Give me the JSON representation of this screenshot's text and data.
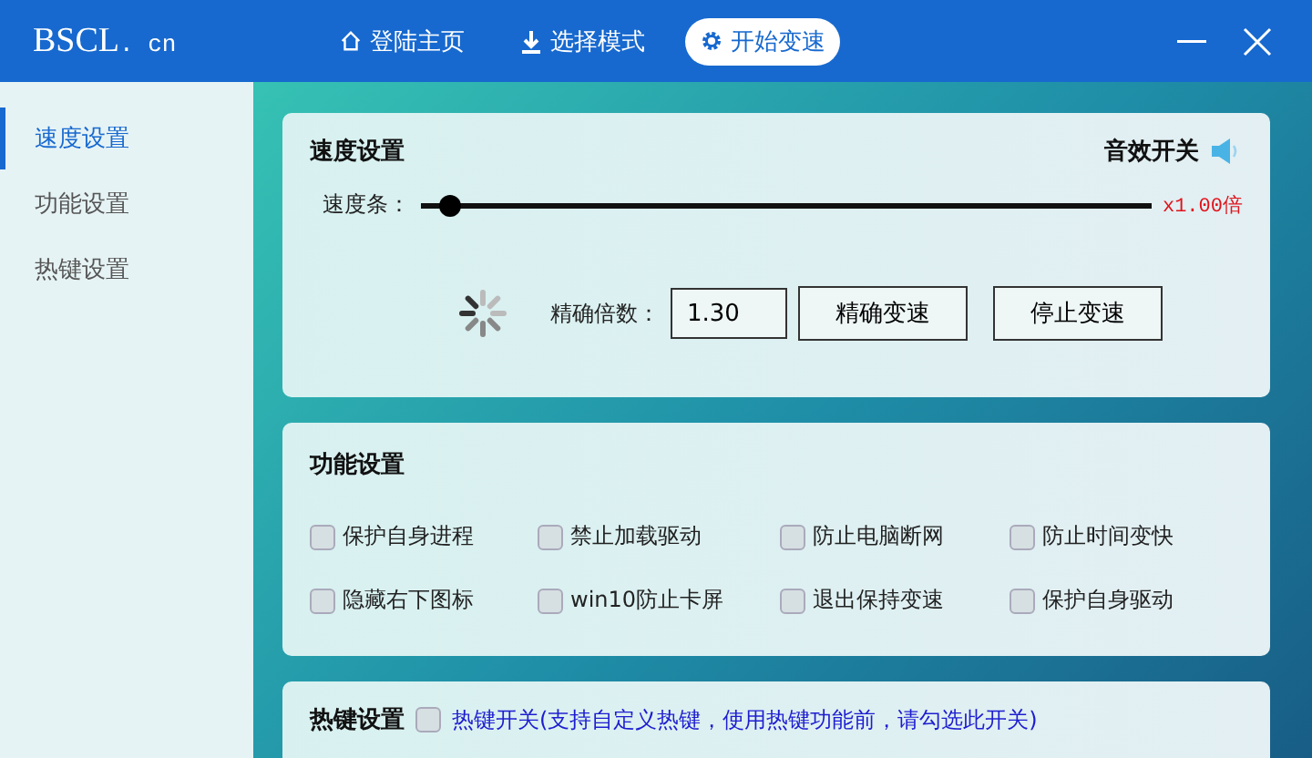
{
  "header": {
    "logo": "BSCL",
    "logo_suffix": ". cn",
    "nav": [
      {
        "label": "登陆主页",
        "kind": "home",
        "selected": false
      },
      {
        "label": "选择模式",
        "kind": "download",
        "selected": false
      },
      {
        "label": "开始变速",
        "kind": "gear",
        "selected": true
      }
    ]
  },
  "sidebar": {
    "items": [
      {
        "label": "速度设置",
        "selected": true
      },
      {
        "label": "功能设置",
        "selected": false
      },
      {
        "label": "热键设置",
        "selected": false
      }
    ]
  },
  "speed_panel": {
    "title": "速度设置",
    "sound_label": "音效开关",
    "slider_label": "速度条：",
    "slider": {
      "level": 0.04
    },
    "reading": "x1.00倍",
    "precise_label": "精确倍数：",
    "precise_value": "1.30",
    "buttons": [
      "精确变速",
      "停止变速"
    ]
  },
  "function_panel": {
    "title": "功能设置",
    "options": [
      {
        "label": "保护自身进程",
        "checked": false
      },
      {
        "label": "禁止加载驱动",
        "checked": false
      },
      {
        "label": "防止电脑断网",
        "checked": false
      },
      {
        "label": "防止时间变快",
        "checked": false
      },
      {
        "label": "隐藏右下图标",
        "checked": false
      },
      {
        "label": "win10防止卡屏",
        "checked": false
      },
      {
        "label": "退出保持变速",
        "checked": false
      },
      {
        "label": "保护自身驱动",
        "checked": false
      }
    ]
  },
  "hotkey_panel": {
    "title": "热键设置",
    "toggle": {
      "label": "热键开关(支持自定义热键，使用热键功能前，请勾选此开关)",
      "checked": false
    }
  }
}
